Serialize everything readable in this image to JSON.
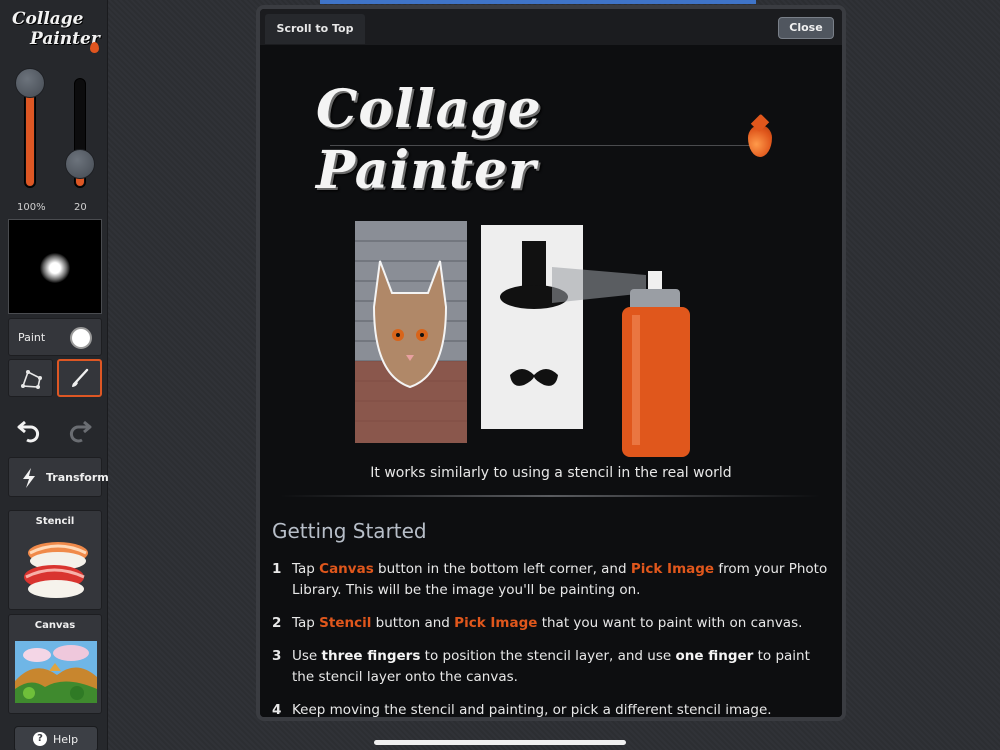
{
  "sidebar": {
    "logo": {
      "line1": "Collage",
      "line2": "Painter"
    },
    "opacity_value": "100%",
    "size_value": "20",
    "opacity_level": 1.0,
    "size_level": 0.2,
    "paint_label": "Paint",
    "transform_label": "Transform",
    "stencil_label": "Stencil",
    "canvas_label": "Canvas",
    "help_label": "Help"
  },
  "modal": {
    "scroll_to_top_label": "Scroll to Top",
    "close_label": "Close",
    "logo_text": "Collage Painter",
    "caption": "It works similarly to using a stencil in the real world",
    "section_title": "Getting Started",
    "steps": [
      {
        "num": "1",
        "t1": "Tap ",
        "h1": "Canvas",
        "t2": " button in the bottom left corner, and ",
        "h2": "Pick Image",
        "t3": " from your Photo Library. This will be the image you'll be painting on."
      },
      {
        "num": "2",
        "t1": "Tap ",
        "h1": "Stencil",
        "t2": " button and ",
        "h2": "Pick Image",
        "t3": " that you want to paint with on canvas."
      },
      {
        "num": "3",
        "t1": "Use ",
        "b1": "three fingers",
        "t2": " to position the stencil layer, and use ",
        "b2": "one finger",
        "t3": " to paint the stencil layer onto the canvas."
      },
      {
        "num": "4",
        "t1": "Keep moving the stencil and painting, or pick a different stencil image."
      }
    ]
  },
  "colors": {
    "accent": "#de5724",
    "panel": "#26282c",
    "modal_bg": "#0d0e10",
    "heading": "#b7bec8"
  }
}
